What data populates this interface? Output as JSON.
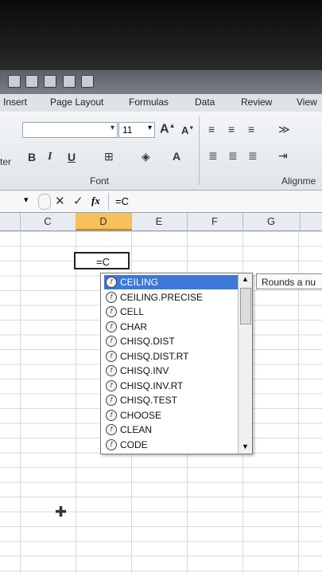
{
  "tabs": [
    "Insert",
    "Page Layout",
    "Formulas",
    "Data",
    "Review",
    "View"
  ],
  "ribbon": {
    "font_size": "11",
    "left_cut_label": "ter",
    "bold": "B",
    "italic": "I",
    "underline": "U",
    "font_group_label": "Font",
    "alignment_group_label": "Alignme"
  },
  "formula_bar": {
    "cancel": "✕",
    "enter": "✓",
    "fx": "fx",
    "content": "=C"
  },
  "columns": [
    "C",
    "D",
    "E",
    "F",
    "G"
  ],
  "active_cell": {
    "column": "D",
    "content": "=C"
  },
  "autocomplete": {
    "items": [
      "CEILING",
      "CEILING.PRECISE",
      "CELL",
      "CHAR",
      "CHISQ.DIST",
      "CHISQ.DIST.RT",
      "CHISQ.INV",
      "CHISQ.INV.RT",
      "CHISQ.TEST",
      "CHOOSE",
      "CLEAN",
      "CODE"
    ],
    "selected": "CEILING"
  },
  "tooltip": "Rounds a nu",
  "colors": {
    "selection_blue": "#3c78d8",
    "active_column": "#f6c15a"
  },
  "icons": [
    "dropdown-icon",
    "cancel-icon",
    "enter-icon",
    "function-icon",
    "scroll-up-icon",
    "scroll-down-icon",
    "cursor-cross-icon"
  ]
}
